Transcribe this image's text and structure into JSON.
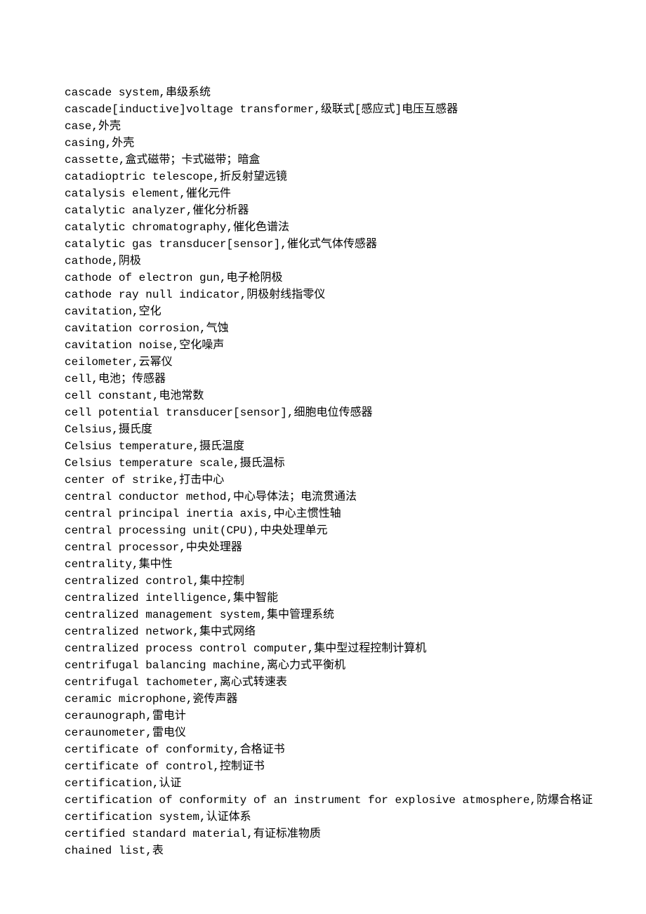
{
  "entries": [
    "cascade system,串级系统",
    "cascade[inductive]voltage transformer,级联式[感应式]电压互感器",
    "case,外壳",
    "casing,外壳",
    "cassette,盒式磁带；卡式磁带；暗盒",
    "catadioptric telescope,折反射望远镜",
    "catalysis element,催化元件",
    "catalytic analyzer,催化分析器",
    "catalytic chromatography,催化色谱法",
    "catalytic gas transducer[sensor],催化式气体传感器",
    "cathode,阴极",
    "cathode of electron gun,电子枪阴极",
    "cathode ray null indicator,阴极射线指零仪",
    "cavitation,空化",
    "cavitation corrosion,气蚀",
    "cavitation noise,空化噪声",
    "ceilometer,云幂仪",
    "cell,电池；传感器",
    "cell constant,电池常数",
    "cell potential transducer[sensor],细胞电位传感器",
    "Celsius,摄氏度",
    "Celsius temperature,摄氏温度",
    "Celsius temperature scale,摄氏温标",
    "center of strike,打击中心",
    "central conductor method,中心导体法；电流贯通法",
    "central principal inertia axis,中心主惯性轴",
    "central processing unit(CPU),中央处理单元",
    "central processor,中央处理器",
    "centrality,集中性",
    "centralized control,集中控制",
    "centralized intelligence,集中智能",
    "centralized management system,集中管理系统",
    "centralized network,集中式网络",
    "centralized process control computer,集中型过程控制计算机",
    "centrifugal balancing machine,离心力式平衡机",
    "centrifugal tachometer,离心式转速表",
    "ceramic microphone,瓷传声器",
    "ceraunograph,雷电计",
    "ceraunometer,雷电仪",
    "certificate of conformity,合格证书",
    "certificate of control,控制证书",
    "certification,认证",
    "certification of conformity of an instrument for explosive atmosphere,防爆合格证",
    "certification system,认证体系",
    "certified standard material,有证标准物质",
    "chained list,表"
  ]
}
